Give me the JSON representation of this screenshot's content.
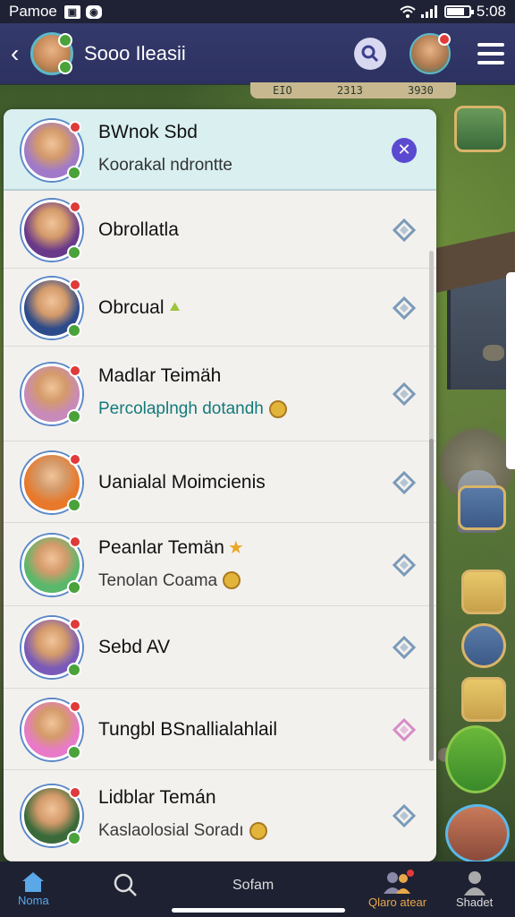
{
  "status_bar": {
    "carrier": "Pamoe",
    "icon1": "▣",
    "icon2": "◉",
    "time": "5:08",
    "battery_level": 0.8
  },
  "app_bar": {
    "title": "Sooo Ileasii",
    "icons": [
      "back-icon",
      "search-icon",
      "menu-icon"
    ]
  },
  "hud": {
    "values": [
      "EIO",
      "2313",
      "3930"
    ]
  },
  "chats": [
    {
      "name": "BWnok Sbd",
      "subtitle": "Koorakal ndrontte",
      "action": "close",
      "selected": true,
      "avatar_color": "#a07ac8"
    },
    {
      "name": "Obrollatla",
      "subtitle": "",
      "action": "diamond",
      "avatar_color": "#6a3a8a"
    },
    {
      "name": "Obrcual",
      "subtitle": "",
      "emoji": "leaf",
      "action": "diamond",
      "avatar_color": "#2d4a8a"
    },
    {
      "name": "Madlar Teimäh",
      "subtitle": "Percolaplngh dotandh",
      "subtitle_emoji": "coin",
      "subtitle_style": "teal",
      "action": "diamond",
      "avatar_color": "#c88ab8"
    },
    {
      "name": "Uanialal Moimcienis",
      "subtitle": "",
      "action": "diamond",
      "avatar_color": "#e8782a"
    },
    {
      "name": "Peanlar Temän",
      "subtitle": "Tenolan Coama",
      "emoji": "star",
      "subtitle_emoji": "coin",
      "subtitle_style": "gray",
      "action": "diamond",
      "avatar_color": "#5ab86a"
    },
    {
      "name": "Sebd AV",
      "subtitle": "",
      "action": "diamond",
      "avatar_color": "#7a5ab8"
    },
    {
      "name": "Tungbl BSnallialahlail",
      "subtitle": "",
      "action": "diamond-pink",
      "avatar_color": "#e87ac8"
    },
    {
      "name": "Lidblar Temán",
      "subtitle": "Kaslaolosial Soradı",
      "subtitle_emoji": "coin",
      "subtitle_style": "gray",
      "action": "diamond",
      "avatar_color": "#3a6a3a"
    }
  ],
  "bottom_nav": {
    "items": [
      {
        "label": "Noma",
        "icon": "home-icon"
      },
      {
        "label": "",
        "icon": "search-icon"
      },
      {
        "label": "Sofam",
        "icon": ""
      },
      {
        "label": "Qlaro atear",
        "icon": "friends-icon"
      },
      {
        "label": "Shadet",
        "icon": "profile-icon"
      }
    ]
  },
  "colors": {
    "appbar": "#2c3160",
    "panel": "#f3f1ee",
    "selected_row": "#d9eff0",
    "accent": "#5a4ad0",
    "teal_text": "#137a7a"
  }
}
